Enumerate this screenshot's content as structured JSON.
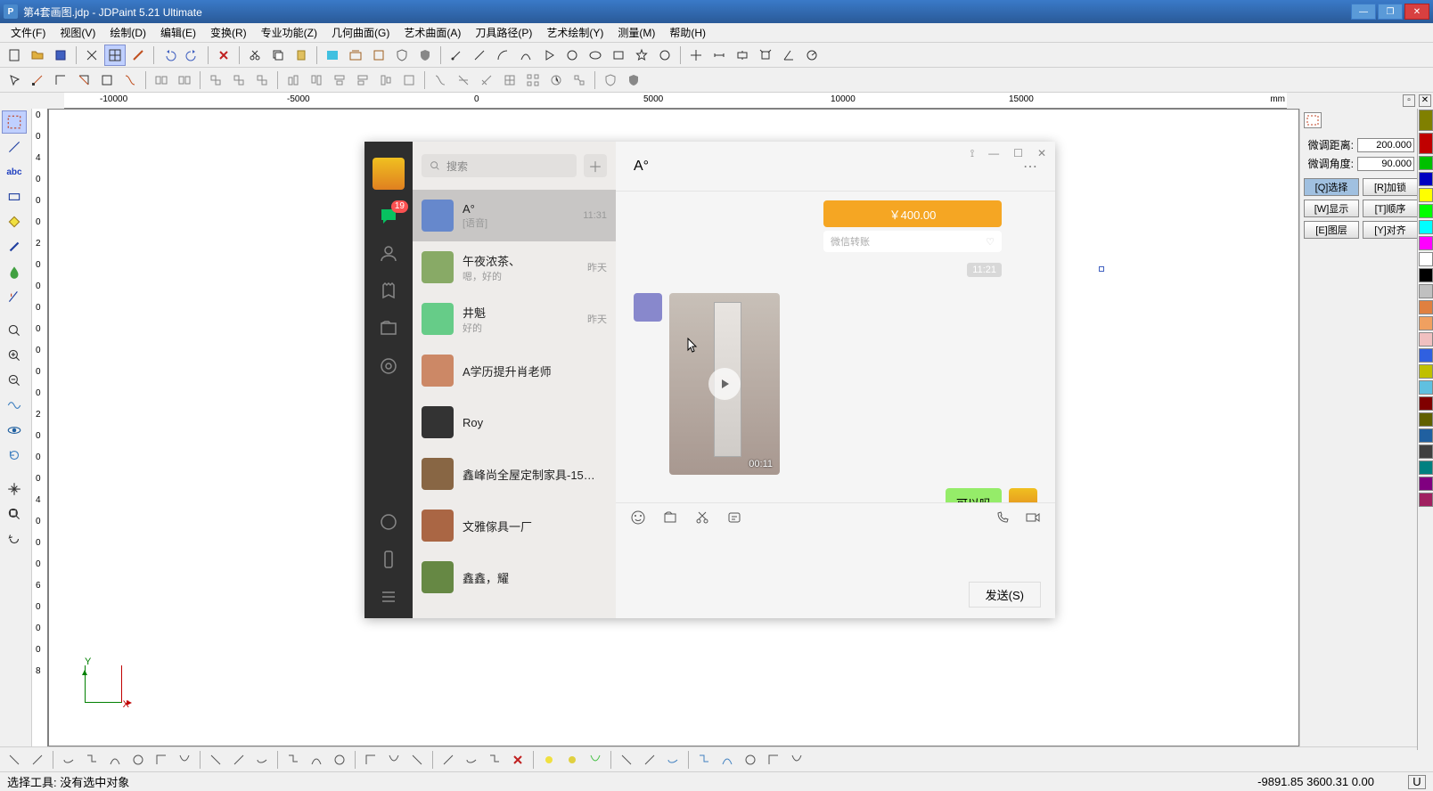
{
  "titlebar": {
    "icon": "P",
    "text": "第4套画图.jdp - JDPaint 5.21 Ultimate"
  },
  "menu": [
    "文件(F)",
    "视图(V)",
    "绘制(D)",
    "编辑(E)",
    "变换(R)",
    "专业功能(Z)",
    "几何曲面(G)",
    "艺术曲面(A)",
    "刀具路径(P)",
    "艺术绘制(Y)",
    "测量(M)",
    "帮助(H)"
  ],
  "ruler": {
    "marks": [
      "-10000",
      "-5000",
      "0",
      "5000",
      "10000",
      "15000"
    ],
    "unit": "mm",
    "vmarks": [
      "0",
      "0",
      "4",
      "0",
      "0",
      "0",
      "2",
      "0",
      "0",
      "0",
      "0",
      "0",
      "0",
      "0",
      "2",
      "0",
      "0",
      "0",
      "4",
      "0",
      "0",
      "0",
      "6",
      "0",
      "0",
      "0",
      "8"
    ]
  },
  "panel": {
    "dist_label": "微调距离:",
    "dist_value": "200.000",
    "angle_label": "微调角度:",
    "angle_value": "90.000",
    "buttons": [
      "[Q]选择",
      "[R]加锁",
      "[W]显示",
      "[T]顺序",
      "[E]图层",
      "[Y]对齐"
    ]
  },
  "colors": [
    "#808000",
    "#c00000",
    "#00c000",
    "#0000c0",
    "#ffff00",
    "#00ff00",
    "#00ffff",
    "#ff00ff",
    "#ffffff",
    "#000000",
    "#c0c0c0",
    "#e08040",
    "#f0a060",
    "#f0c0c0",
    "#3060e0",
    "#c0c000",
    "#60c0e0",
    "#800000",
    "#606000",
    "#2060a0",
    "#404040",
    "#008080",
    "#800080",
    "#a02060"
  ],
  "bottom_tools": 30,
  "statusbar": {
    "left": "选择工具: 没有选中对象",
    "coords": "-9891.85 3600.31 0.00",
    "mode": "U"
  },
  "axis": {
    "y": "Y",
    "x": "X"
  },
  "wechat": {
    "search_placeholder": "搜索",
    "badge": "19",
    "chats": [
      {
        "name": "A°",
        "msg": "[语音]",
        "time": "11:31",
        "active": true
      },
      {
        "name": "午夜浓茶、",
        "msg": "嗯，好的",
        "time": "昨天"
      },
      {
        "name": "井魁",
        "msg": "好的",
        "time": "昨天"
      },
      {
        "name": "A学历提升肖老师",
        "msg": "",
        "time": ""
      },
      {
        "name": "Roy",
        "msg": "",
        "time": ""
      },
      {
        "name": "鑫峰尚全屋定制家具-1573...",
        "msg": "",
        "time": ""
      },
      {
        "name": "文雅傢具一厂",
        "msg": "",
        "time": ""
      },
      {
        "name": "鑫鑫，耀",
        "msg": "",
        "time": ""
      }
    ],
    "header_title": "A°",
    "orange_card": "￥400.00",
    "white_bar": "微信转账",
    "time_badge": "11:21",
    "video_duration": "00:11",
    "out_msg": "可以吗",
    "send_label": "发送(S)"
  }
}
